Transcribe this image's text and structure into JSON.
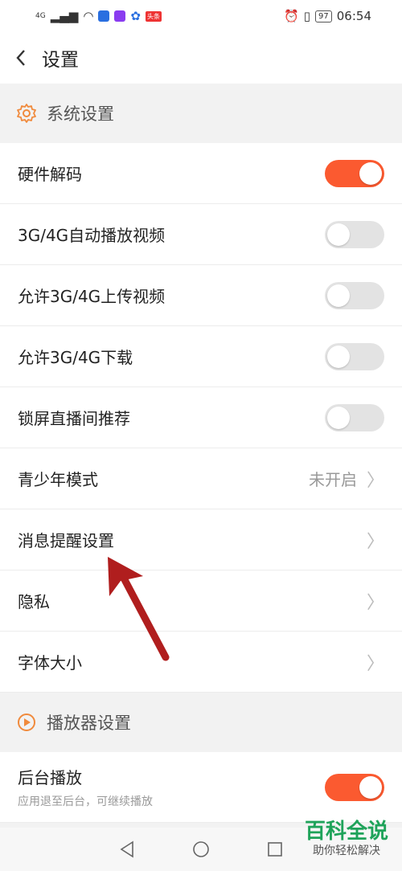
{
  "status_bar": {
    "network": "4G",
    "carrier_badge": "头条",
    "battery": "97",
    "time": "06:54"
  },
  "header": {
    "title": "设置"
  },
  "sections": {
    "system": {
      "title": "系统设置",
      "rows": [
        {
          "label": "硬件解码",
          "toggle": "on"
        },
        {
          "label": "3G/4G自动播放视频",
          "toggle": "off"
        },
        {
          "label": "允许3G/4G上传视频",
          "toggle": "off"
        },
        {
          "label": "允许3G/4G下载",
          "toggle": "off"
        },
        {
          "label": "锁屏直播间推荐",
          "toggle": "off"
        },
        {
          "label": "青少年模式",
          "value": "未开启"
        },
        {
          "label": "消息提醒设置"
        },
        {
          "label": "隐私"
        },
        {
          "label": "字体大小"
        }
      ]
    },
    "player": {
      "title": "播放器设置",
      "rows": [
        {
          "label": "后台播放",
          "sub": "应用退至后台，可继续播放",
          "toggle": "on"
        }
      ]
    }
  },
  "watermark": {
    "title": "百科全说",
    "subtitle": "助你轻松解决"
  },
  "colors": {
    "accent": "#fb5a30",
    "section_icon": "#f08a3c",
    "watermark": "#1fa35a",
    "arrow": "#b01e1e"
  }
}
